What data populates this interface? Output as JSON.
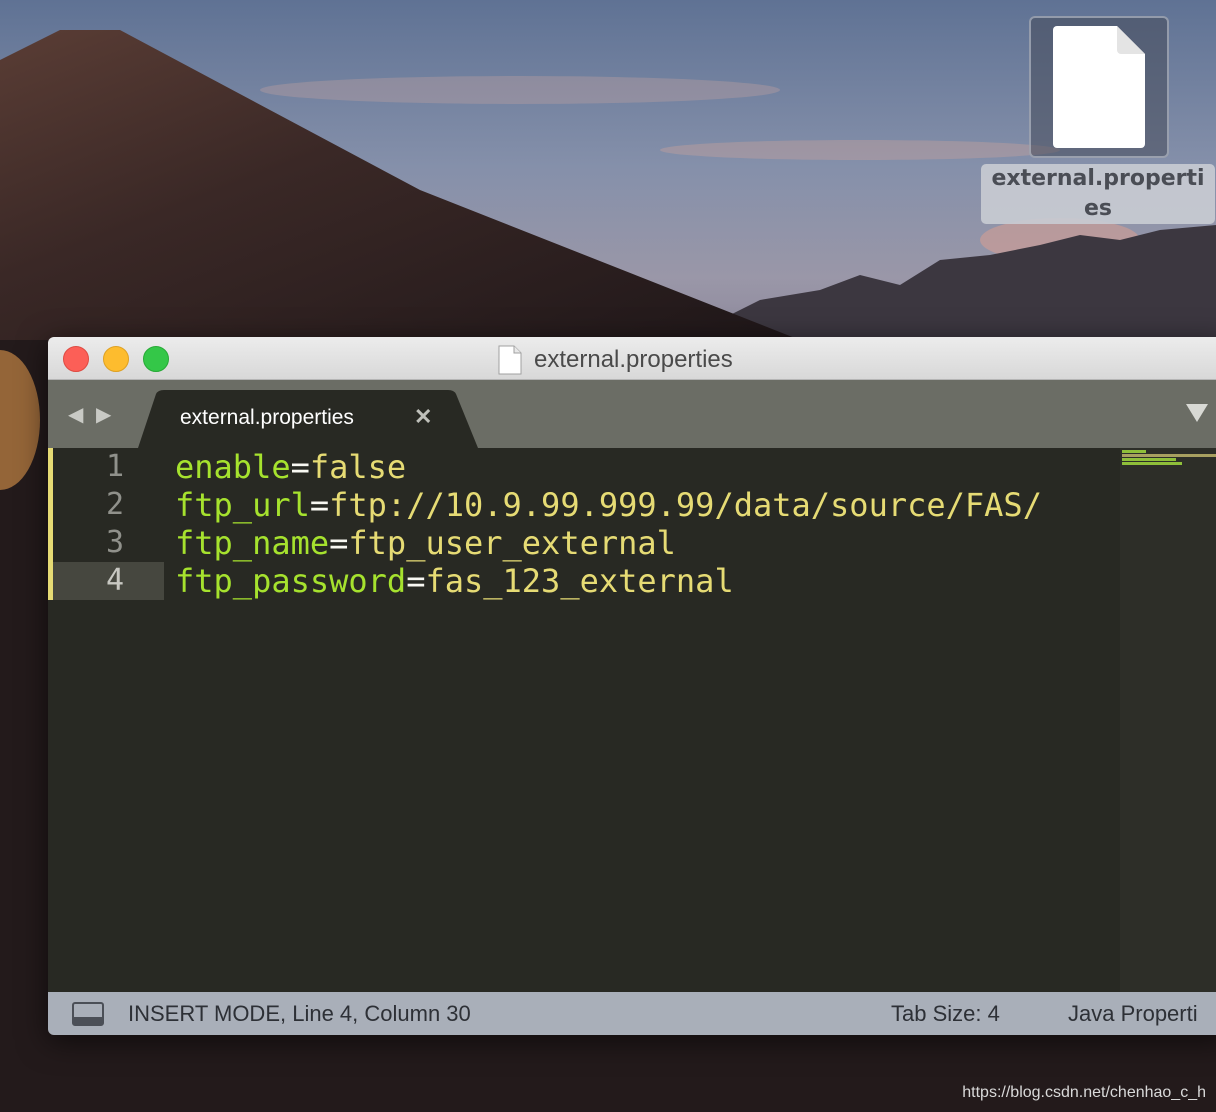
{
  "desktop": {
    "file_icon_label": "external.properties"
  },
  "window": {
    "title": "external.properties",
    "tab": {
      "label": "external.properties",
      "close_glyph": "✕"
    },
    "nav": {
      "back_glyph": "◀",
      "forward_glyph": "▶"
    },
    "editor": {
      "lines": [
        {
          "number": "1",
          "key": "enable",
          "value": "false"
        },
        {
          "number": "2",
          "key": "ftp_url",
          "value": "ftp://10.9.99.999.99/data/source/FAS/"
        },
        {
          "number": "3",
          "key": "ftp_name",
          "value": "ftp_user_external"
        },
        {
          "number": "4",
          "key": "ftp_password",
          "value": "fas_123_external"
        }
      ],
      "operator": "=",
      "current_line": 4
    },
    "statusbar": {
      "mode_text": "INSERT MODE, Line 4, Column 30",
      "tab_size": "Tab Size: 4",
      "syntax": "Java Properti"
    }
  },
  "watermark": "https://blog.csdn.net/chenhao_c_h",
  "colors": {
    "editor_bg": "#282923",
    "key": "#a6e22e",
    "value": "#e6db74",
    "operator": "#f8f8f2"
  },
  "icons": [
    "document-icon",
    "close-icon",
    "chevron-left-icon",
    "chevron-right-icon",
    "dropdown-triangle-icon",
    "panel-toggle-icon"
  ]
}
